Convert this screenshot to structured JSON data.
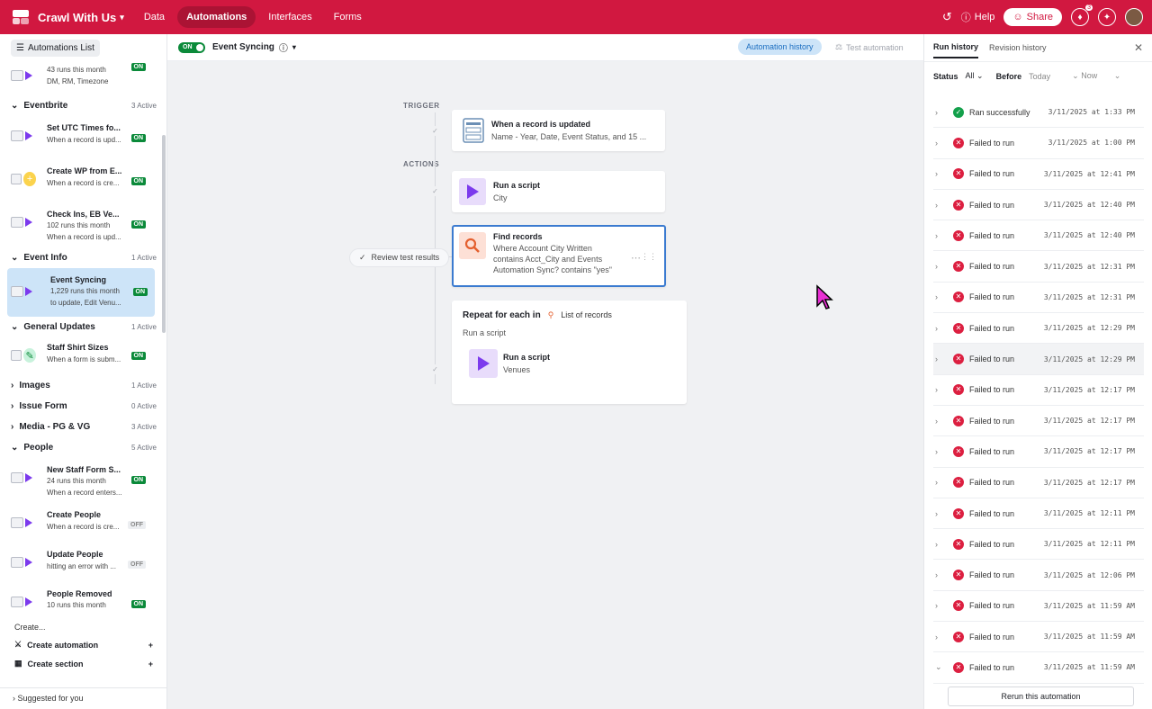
{
  "topbar": {
    "base_name": "Crawl With Us",
    "nav": [
      "Data",
      "Automations",
      "Interfaces",
      "Forms"
    ],
    "active_nav": "Automations",
    "help": "Help",
    "share": "Share",
    "notification_count": "3"
  },
  "sidebar": {
    "header": "Automations List",
    "top_item": {
      "runs": "43 runs this month",
      "desc": "DM, RM, Timezone",
      "status": "ON"
    },
    "sections": [
      {
        "name": "Eventbrite",
        "count": "3 Active",
        "items": [
          {
            "title": "Set UTC Times fo...",
            "desc": "When a record is upd...",
            "status": "ON"
          },
          {
            "title": "Create WP from E...",
            "desc": "When a record is cre...",
            "status": "ON"
          },
          {
            "title": "Check Ins, EB Ve...",
            "runs": "102 runs this month",
            "desc": "When a record is upd...",
            "status": "ON"
          }
        ]
      },
      {
        "name": "Event Info",
        "count": "1 Active",
        "items": [
          {
            "title": "Event Syncing",
            "runs": "1,229 runs this month",
            "desc": "to update, Edit Venu...",
            "status": "ON"
          }
        ]
      },
      {
        "name": "General Updates",
        "count": "1 Active",
        "items": [
          {
            "title": "Staff Shirt Sizes",
            "desc": "When a form is subm...",
            "status": "ON"
          }
        ]
      },
      {
        "name": "Images",
        "count": "1 Active"
      },
      {
        "name": "Issue Form",
        "count": "0 Active"
      },
      {
        "name": "Media - PG & VG",
        "count": "3 Active"
      },
      {
        "name": "People",
        "count": "5 Active",
        "items": [
          {
            "title": "New Staff Form S...",
            "runs": "24 runs this month",
            "desc": "When a record enters...",
            "status": "ON"
          },
          {
            "title": "Create People",
            "desc": "When a record is cre...",
            "status": "OFF"
          },
          {
            "title": "Update People",
            "desc": "hitting an error with ...",
            "status": "OFF"
          },
          {
            "title": "People Removed",
            "runs": "10 runs this month",
            "status": "ON"
          }
        ]
      }
    ],
    "create_label": "Create...",
    "create_automation": "Create automation",
    "create_section": "Create section",
    "suggested": "Suggested for you"
  },
  "toolbar": {
    "toggle": "ON",
    "automation_name": "Event Syncing",
    "history_button": "Automation history",
    "test_button": "Test automation"
  },
  "canvas": {
    "trigger_label": "TRIGGER",
    "actions_label": "ACTIONS",
    "trigger": {
      "title": "When a record is updated",
      "desc": "Name - Year, Date, Event Status, and 15 ..."
    },
    "action1": {
      "title": "Run a script",
      "desc": "City"
    },
    "action2": {
      "title": "Find records",
      "desc1": "Where Account City Written",
      "desc2": "contains Acct_City and Events",
      "desc3": "Automation Sync? contains \"yes\""
    },
    "review": "Review test results",
    "repeat": {
      "title": "Repeat for each in",
      "list": "List of records",
      "sub": "Run a script",
      "inner_title": "Run a script",
      "inner_desc": "Venues"
    }
  },
  "run_panel": {
    "tabs": [
      "Run history",
      "Revision history"
    ],
    "filter": {
      "status_label": "Status",
      "status_value": "All",
      "before_label": "Before",
      "before_value": "Today",
      "now_value": "Now"
    },
    "runs": [
      {
        "status": "ok",
        "label": "Ran successfully",
        "time": "3/11/2025 at 1:33 PM"
      },
      {
        "status": "bad",
        "label": "Failed to run",
        "time": "3/11/2025 at 1:00 PM"
      },
      {
        "status": "bad",
        "label": "Failed to run",
        "time": "3/11/2025 at 12:41 PM"
      },
      {
        "status": "bad",
        "label": "Failed to run",
        "time": "3/11/2025 at 12:40 PM"
      },
      {
        "status": "bad",
        "label": "Failed to run",
        "time": "3/11/2025 at 12:40 PM"
      },
      {
        "status": "bad",
        "label": "Failed to run",
        "time": "3/11/2025 at 12:31 PM"
      },
      {
        "status": "bad",
        "label": "Failed to run",
        "time": "3/11/2025 at 12:31 PM"
      },
      {
        "status": "bad",
        "label": "Failed to run",
        "time": "3/11/2025 at 12:29 PM"
      },
      {
        "status": "bad",
        "label": "Failed to run",
        "time": "3/11/2025 at 12:29 PM"
      },
      {
        "status": "bad",
        "label": "Failed to run",
        "time": "3/11/2025 at 12:17 PM"
      },
      {
        "status": "bad",
        "label": "Failed to run",
        "time": "3/11/2025 at 12:17 PM"
      },
      {
        "status": "bad",
        "label": "Failed to run",
        "time": "3/11/2025 at 12:17 PM"
      },
      {
        "status": "bad",
        "label": "Failed to run",
        "time": "3/11/2025 at 12:17 PM"
      },
      {
        "status": "bad",
        "label": "Failed to run",
        "time": "3/11/2025 at 12:11 PM"
      },
      {
        "status": "bad",
        "label": "Failed to run",
        "time": "3/11/2025 at 12:11 PM"
      },
      {
        "status": "bad",
        "label": "Failed to run",
        "time": "3/11/2025 at 12:06 PM"
      },
      {
        "status": "bad",
        "label": "Failed to run",
        "time": "3/11/2025 at 11:59 AM"
      },
      {
        "status": "bad",
        "label": "Failed to run",
        "time": "3/11/2025 at 11:59 AM"
      },
      {
        "status": "bad",
        "label": "Failed to run",
        "time": "3/11/2025 at 11:59 AM"
      }
    ],
    "rerun_button": "Rerun this automation"
  },
  "colors": {
    "brand": "#d11840",
    "on_green": "#0b8a3a",
    "accent_blue": "#1a6dc0",
    "script_purple": "#7c3aed",
    "fail_red": "#dc1f40"
  }
}
